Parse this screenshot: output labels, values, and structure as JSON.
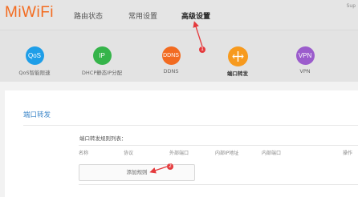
{
  "app": {
    "logo": "MiWiFi",
    "user_link": "Sup"
  },
  "nav": {
    "items": [
      {
        "label": "路由状态"
      },
      {
        "label": "常用设置"
      },
      {
        "label": "高级设置"
      }
    ]
  },
  "features": [
    {
      "icon": "QoS",
      "label": "QoS智能限速",
      "color": "#1e9ee8"
    },
    {
      "icon": "IP",
      "label": "DHCP静态IP分配",
      "color": "#35b44a"
    },
    {
      "icon": "DDNS",
      "label": "DDNS",
      "color": "#f26b21"
    },
    {
      "icon": "plus-cross",
      "label": "端口转发",
      "color": "#f79a1e"
    },
    {
      "icon": "VPN",
      "label": "VPN",
      "color": "#9b5ccc"
    }
  ],
  "markers": [
    "1",
    "2"
  ],
  "panel": {
    "title": "端口转发",
    "list_title": "端口转发规则列表：",
    "columns": [
      "名称",
      "协议",
      "外部端口",
      "内部IP地址",
      "内部端口",
      "操作"
    ],
    "add_button": "添加规则"
  },
  "colors": {
    "brand": "#f36b1f",
    "link": "#3c86c8",
    "marker": "#e4393c"
  }
}
